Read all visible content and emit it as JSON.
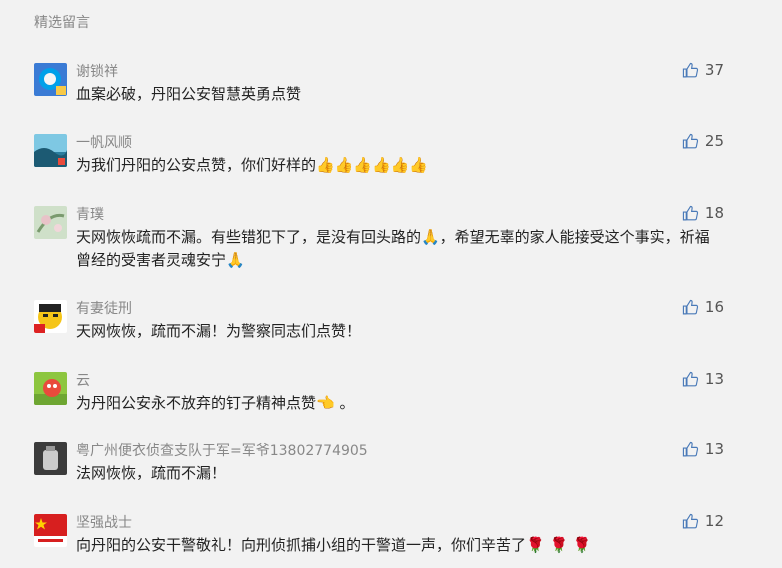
{
  "section_title": "精选留言",
  "comments": [
    {
      "nickname": "谢锁祥",
      "text": "血案必破，丹阳公安智慧英勇点赞",
      "likes": "37",
      "avatar_colors": [
        "#3a7bd5",
        "#00a0e9"
      ]
    },
    {
      "nickname": "一帆风顺",
      "text": "为我们丹阳的公安点赞，你们好样的👍👍👍👍👍👍",
      "likes": "25",
      "avatar_colors": [
        "#2b7d9e",
        "#7ec8e3"
      ]
    },
    {
      "nickname": "青璞",
      "text": "天网恢恢疏而不漏。有些错犯下了，是没有回头路的🙏，希望无辜的家人能接受这个事实，祈福曾经的受害者灵魂安宁🙏",
      "likes": "18",
      "avatar_colors": [
        "#a9c9a4",
        "#e8c3c8"
      ]
    },
    {
      "nickname": "有妻徒刑",
      "text": "天网恢恢，疏而不漏！为警察同志们点赞！",
      "likes": "16",
      "avatar_colors": [
        "#f5c518",
        "#d22"
      ]
    },
    {
      "nickname": "云",
      "text": "为丹阳公安永不放弃的钉子精神点赞👈 。",
      "likes": "13",
      "avatar_colors": [
        "#8dc63f",
        "#e94b3c"
      ]
    },
    {
      "nickname": "粤广州便衣侦查支队于军=军爷13802774905",
      "text": "法网恢恢，疏而不漏！",
      "likes": "13",
      "avatar_colors": [
        "#3b3b3b",
        "#cccccc"
      ]
    },
    {
      "nickname": "坚强战士",
      "text": "向丹阳的公安干警敬礼！向刑侦抓捕小组的干警道一声，你们辛苦了🌹 🌹 🌹",
      "likes": "12",
      "avatar_colors": [
        "#d71f1f",
        "#ffd200"
      ]
    }
  ]
}
